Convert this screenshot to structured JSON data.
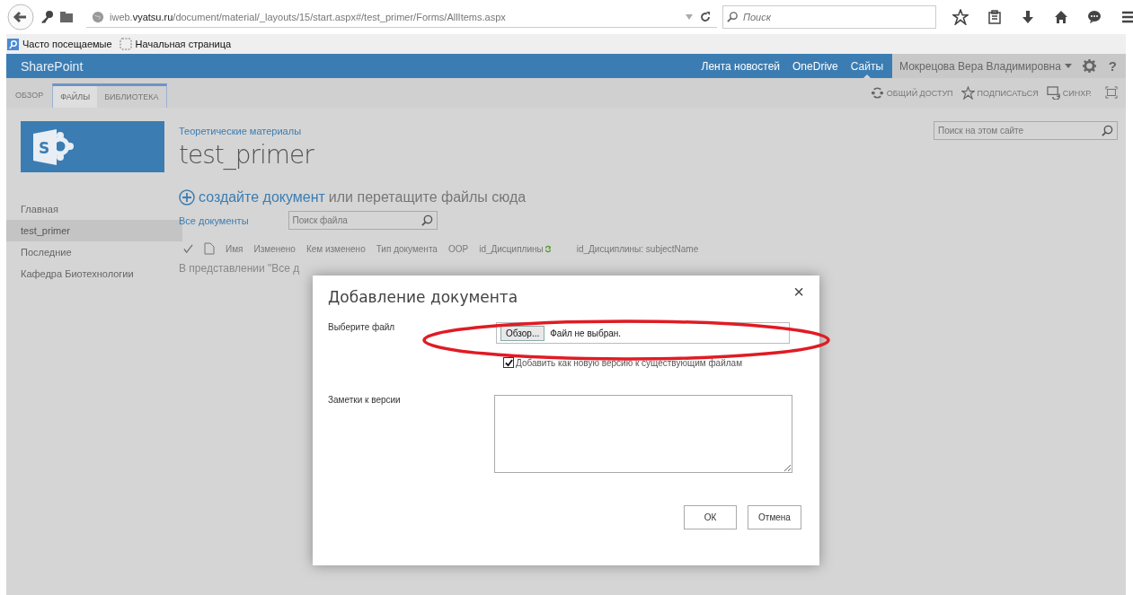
{
  "browser": {
    "url": "iweb.**vyatsu.ru**/document/material/_layouts/15/start.aspx#/test_primer/Forms/AllItems.aspx",
    "search_placeholder": "Поиск",
    "bookmarks": [
      {
        "label": "Часто посещаемые",
        "kind": "search"
      },
      {
        "label": "Начальная страница",
        "kind": "page"
      }
    ]
  },
  "suite_bar": {
    "brand": "SharePoint",
    "links": [
      {
        "label": "Лента новостей",
        "selected": false
      },
      {
        "label": "OneDrive",
        "selected": false
      },
      {
        "label": "Сайты",
        "selected": true
      }
    ],
    "user": "Мокрецова Вера Владимировна",
    "help": "?"
  },
  "ribbon": {
    "tabs": [
      {
        "label": "ОБЗОР",
        "selected": false,
        "contextual": false
      },
      {
        "label": "ФАЙЛЫ",
        "selected": true,
        "contextual": true
      },
      {
        "label": "БИБЛИОТЕКА",
        "selected": false,
        "contextual": true
      }
    ],
    "actions": [
      {
        "label": "ОБЩИЙ ДОСТУП",
        "kind": "share"
      },
      {
        "label": "ПОДПИСАТЬСЯ",
        "kind": "follow"
      },
      {
        "label": "СИНХР.",
        "kind": "sync"
      }
    ]
  },
  "logo_letter": "S",
  "breadcrumb": "Теоретические материалы",
  "title": "test_primer",
  "site_search": {
    "placeholder": "Поиск на этом сайте"
  },
  "nav": [
    {
      "label": "Главная",
      "selected": false
    },
    {
      "label": "test_primer",
      "selected": true
    },
    {
      "label": "Последние",
      "selected": false
    },
    {
      "label": "Кафедра Биотехнологии",
      "selected": false
    }
  ],
  "upload": {
    "link": "создайте документ",
    "text": "или перетащите файлы сюда"
  },
  "view": {
    "label": "Все документы",
    "search_placeholder": "Поиск файла"
  },
  "columns": [
    "Имя",
    "Изменено",
    "Кем изменено",
    "Тип документа",
    "ООР",
    "id_Дисциплины",
    "id_Дисциплины: subjectName"
  ],
  "empty_message": "В представлении \"Все д",
  "dialog": {
    "title": "Добавление документа",
    "close": "×",
    "file_label": "Выберите файл",
    "browse": "Обзор...",
    "file_status": "Файл не выбран.",
    "overwrite": {
      "label": "Добавить как новую версию к существующим файлам",
      "checked": true
    },
    "notes_label": "Заметки к версии",
    "buttons": [
      "ОК",
      "Отмена"
    ],
    "highlighted": true
  }
}
